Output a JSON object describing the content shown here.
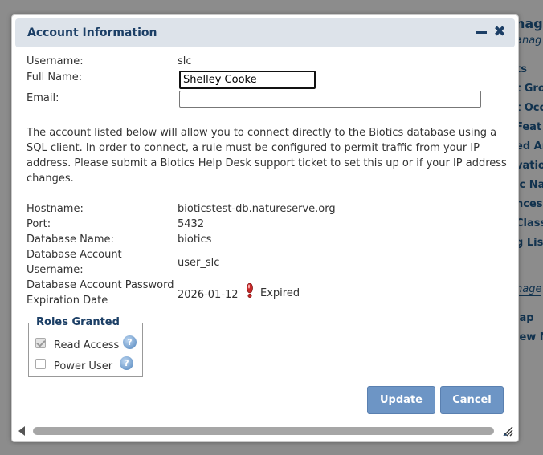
{
  "background_page": {
    "title_fragment": "nage",
    "subtitle_fragment": "anag",
    "items": [
      "ts",
      "t Gro",
      "t Occ",
      "Feat",
      "ed Ar",
      "vatio",
      "ic Na",
      "nces",
      "Class",
      "g List"
    ],
    "subtitle2_fragment": "nage",
    "items2": [
      "lap",
      "iew N"
    ]
  },
  "dialog": {
    "title": "Account Information",
    "minimize_icon": "minimize-icon",
    "close_icon": "close-icon",
    "close_glyph": "✖"
  },
  "account": {
    "username_label": "Username:",
    "username": "slc",
    "fullname_label": "Full Name:",
    "fullname": "Shelley Cooke",
    "email_label": "Email:",
    "email": ""
  },
  "info_text": "The account listed below will allow you to connect directly to the Biotics database using a SQL client. In order to connect, a rule must be configured to permit traffic from your IP address. Please submit a Biotics Help Desk support ticket to set this up or if your IP address changes.",
  "db": {
    "hostname_label": "Hostname:",
    "hostname": "bioticstest-db.natureserve.org",
    "port_label": "Port:",
    "port": "5432",
    "dbname_label": "Database Name:",
    "dbname": "biotics",
    "dbuser_label_1": "Database Account",
    "dbuser_label_2": "Username:",
    "dbuser": "user_slc",
    "pwexp_label_1": "Database Account Password",
    "pwexp_label_2": "Expiration Date",
    "pwexp_date": "2026-01-12",
    "pwexp_status": "Expired",
    "status_icon": "warning-icon"
  },
  "roles": {
    "legend": "Roles Granted",
    "items": [
      {
        "label": "Read Access",
        "checked": true
      },
      {
        "label": "Power User",
        "checked": false
      }
    ],
    "help_icon_glyph": "?"
  },
  "buttons": {
    "update": "Update",
    "cancel": "Cancel"
  },
  "colors": {
    "title_blue": "#1c3f66",
    "button_blue": "#6d95c5",
    "warning_red": "#c62828"
  }
}
